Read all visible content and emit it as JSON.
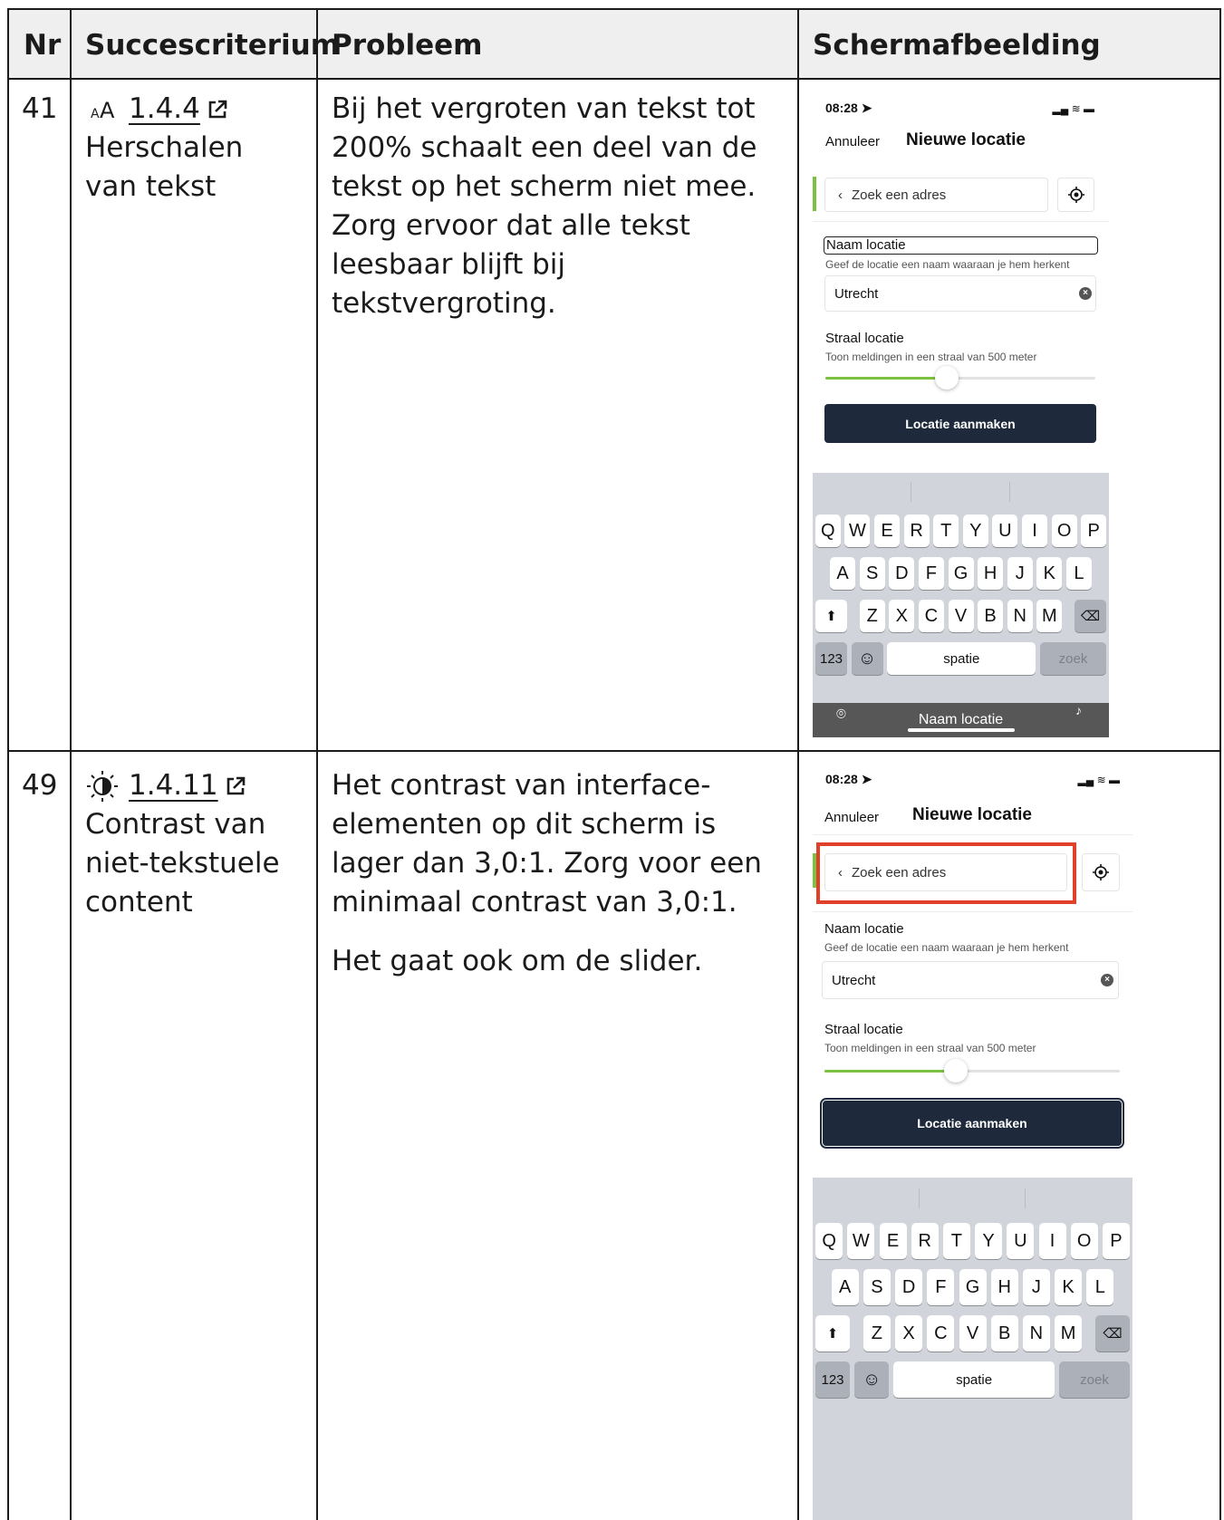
{
  "headers": {
    "nr": "Nr",
    "criterion": "Succescriterium",
    "problem": "Probleem",
    "screenshot": "Schermafbeelding"
  },
  "rows": [
    {
      "nr": "41",
      "criterion_code": "1.4.4",
      "criterion_name": "Herschalen van tekst",
      "criterion_icon": "text-resize-icon",
      "problem": [
        "Bij het vergroten van tekst tot 200% schaalt een deel van de tekst op het scherm niet mee. Zorg ervoor dat alle tekst leesbaar blijft bij tekstvergroting."
      ],
      "phone": {
        "time": "08:28",
        "cancel": "Annuleer",
        "title": "Nieuwe locatie",
        "search": "Zoek een adres",
        "name_label": "Naam locatie",
        "name_hint": "Geef de locatie een naam waaraan je hem herkent",
        "name_value": "Utrecht",
        "radius_label": "Straal locatie",
        "radius_hint": "Toon meldingen in een straal van 500 meter",
        "slider_fraction": 0.45,
        "button": "Locatie aanmaken",
        "kbd_bottom": "Naam locatie"
      }
    },
    {
      "nr": "49",
      "criterion_code": "1.4.11",
      "criterion_name": "Contrast van niet-tekstuele content",
      "criterion_icon": "contrast-icon",
      "problem": [
        "Het contrast van interface-elementen op dit scherm is lager dan 3,0:1. Zorg voor een minimaal contrast van 3,0:1.",
        "Het gaat ook om de slider."
      ],
      "phone": {
        "time": "08:28",
        "cancel": "Annuleer",
        "title": "Nieuwe locatie",
        "search": "Zoek een adres",
        "name_label": "Naam locatie",
        "name_hint": "Geef de locatie een naam waaraan je hem herkent",
        "name_value": "Utrecht",
        "radius_label": "Straal locatie",
        "radius_hint": "Toon meldingen in een straal van 500 meter",
        "slider_fraction": 0.45,
        "button": "Locatie aanmaken",
        "highlight_color": "#e0402a"
      }
    }
  ],
  "keyboard": {
    "row1": [
      "Q",
      "W",
      "E",
      "R",
      "T",
      "Y",
      "U",
      "I",
      "O",
      "P"
    ],
    "row2": [
      "A",
      "S",
      "D",
      "F",
      "G",
      "H",
      "J",
      "K",
      "L"
    ],
    "row3": [
      "Z",
      "X",
      "C",
      "V",
      "B",
      "N",
      "M"
    ],
    "numbers": "123",
    "space": "spatie",
    "go": "zoek"
  }
}
